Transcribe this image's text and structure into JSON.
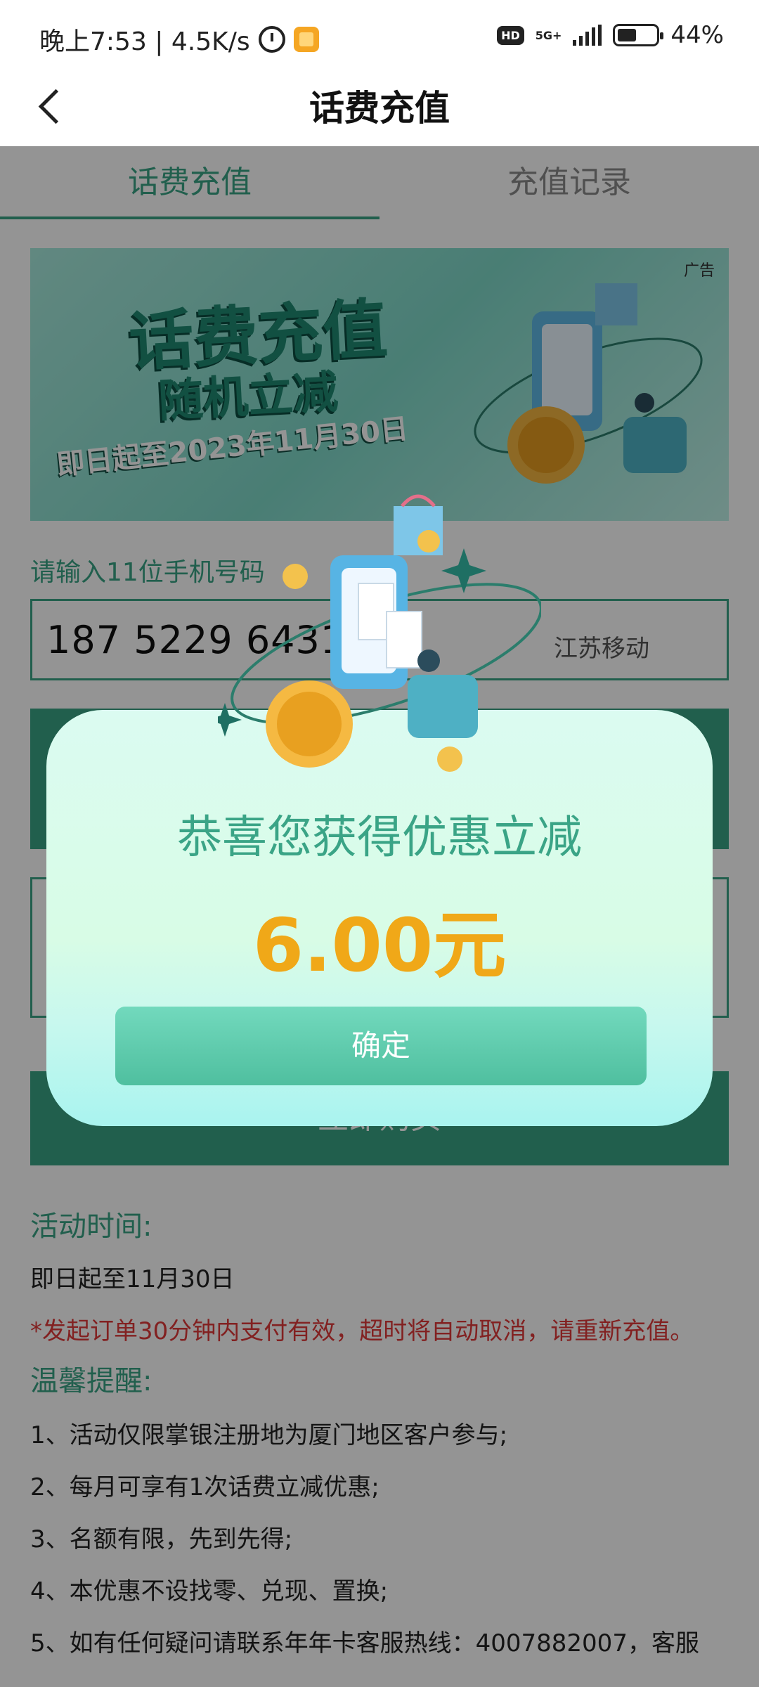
{
  "status_bar": {
    "time_speed": "晚上7:53 | 4.5K/s",
    "hd": "HD",
    "network": "5G+",
    "battery": "44%"
  },
  "header": {
    "title": "话费充值"
  },
  "tabs": [
    {
      "label": "话费充值",
      "active": true
    },
    {
      "label": "充值记录",
      "active": false
    }
  ],
  "banner": {
    "ad_tag": "广告",
    "title": "话费充值",
    "subtitle": "随机立减",
    "date_text": "即日起至2023年11月30日"
  },
  "phone": {
    "label": "请输入11位手机号码",
    "value": "187 5229 6431",
    "carrier": "江苏移动"
  },
  "buy_button": {
    "label": "立即购买"
  },
  "notes": {
    "activity_time_title": "活动时间:",
    "activity_time": "即日起至11月30日",
    "warning": "*发起订单30分钟内支付有效，超时将自动取消，请重新充值。",
    "tips_title": "温馨提醒:",
    "tips": [
      "1、活动仅限掌银注册地为厦门地区客户参与;",
      "2、每月可享有1次话费立减优惠;",
      "3、名额有限，先到先得;",
      "4、本优惠不设找零、兑现、置换;",
      "5、如有任何疑问请联系年年卡客服热线：4007882007，客服"
    ]
  },
  "modal": {
    "title": "恭喜您获得优惠立减",
    "amount": "6.00元",
    "confirm": "确定"
  },
  "colors": {
    "accent": "#3aa486",
    "amount": "#f0a818",
    "warning": "#e03a3a"
  }
}
